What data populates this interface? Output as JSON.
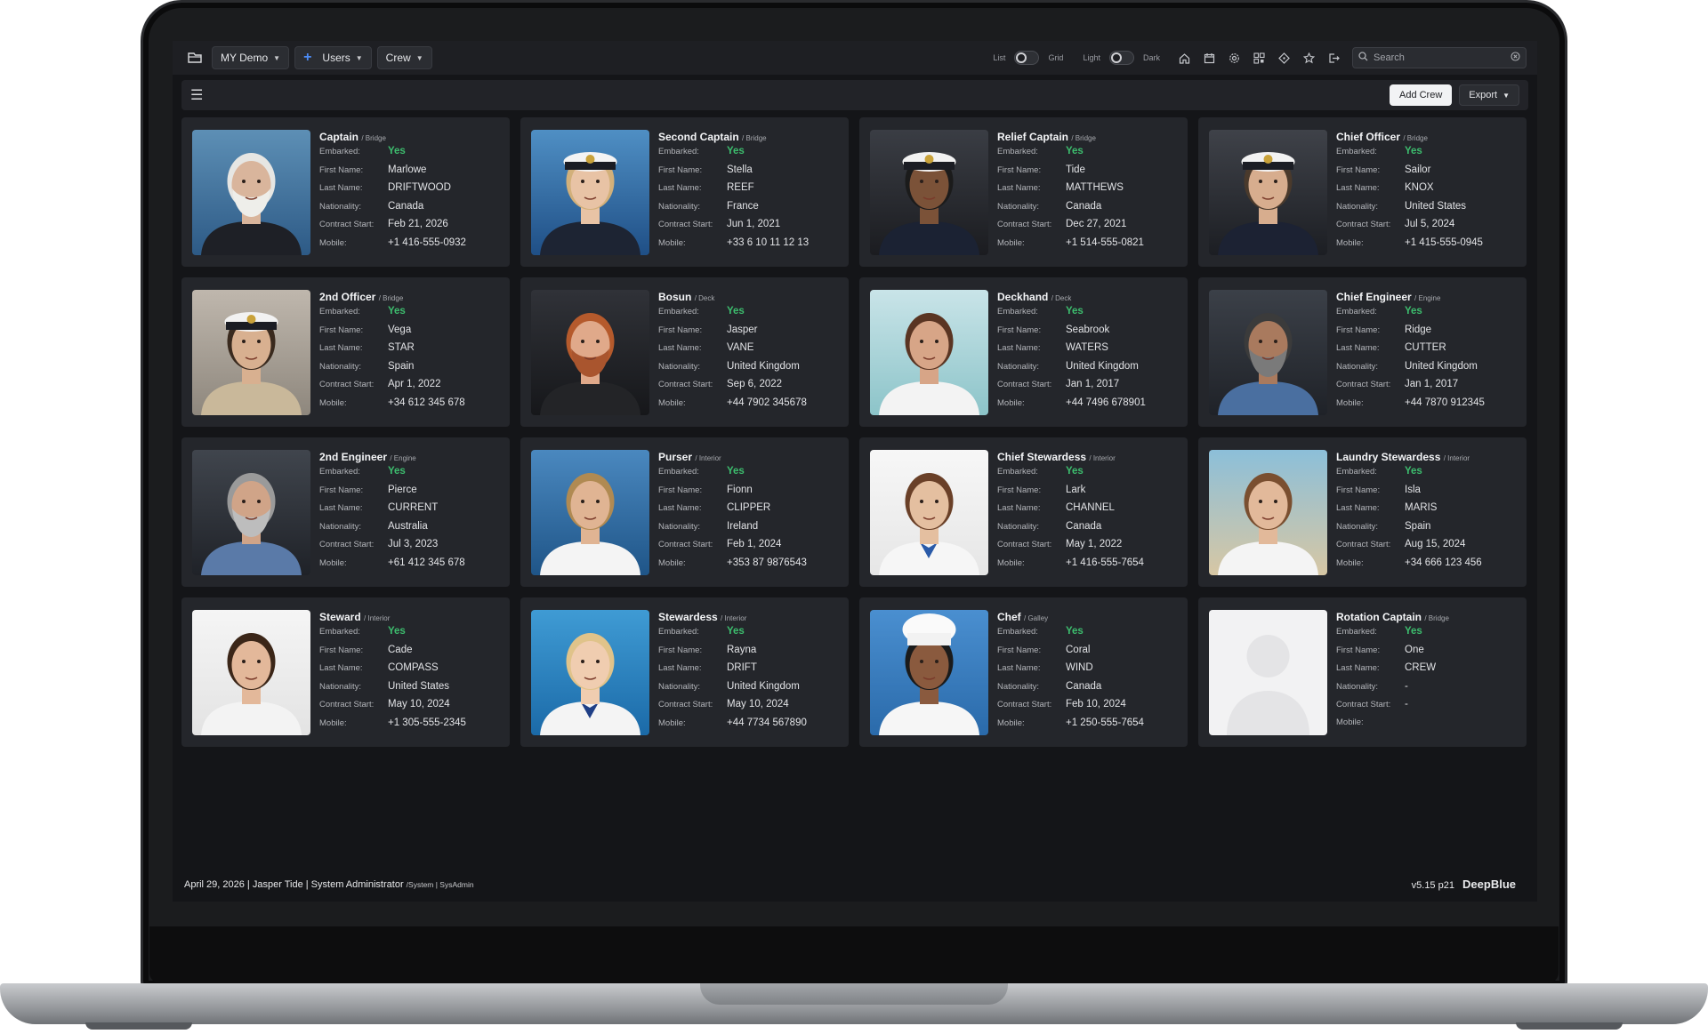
{
  "topbar": {
    "project": "MY Demo",
    "users": "Users",
    "crew": "Crew",
    "list_label": "List",
    "grid_label": "Grid",
    "light_label": "Light",
    "dark_label": "Dark",
    "search_placeholder": "Search",
    "icons": [
      "home-icon",
      "calendar-icon",
      "gear-icon",
      "qr-code-icon",
      "tag-icon",
      "star-icon",
      "logout-icon"
    ]
  },
  "toolbar": {
    "add_crew": "Add Crew",
    "export": "Export"
  },
  "labels": {
    "embarked": "Embarked:",
    "first_name": "First Name:",
    "last_name": "Last Name:",
    "nationality": "Nationality:",
    "contract_start": "Contract Start:",
    "mobile": "Mobile:"
  },
  "crew": [
    {
      "role": "Captain",
      "dept": "/ Bridge",
      "embarked": "Yes",
      "first": "Marlowe",
      "last": "DRIFTWOOD",
      "nationality": "Canada",
      "contract": "Feb 21, 2026",
      "mobile": "+1 416-555-0932",
      "photo": "captain-beard"
    },
    {
      "role": "Second Captain",
      "dept": "/ Bridge",
      "embarked": "Yes",
      "first": "Stella",
      "last": "REEF",
      "nationality": "France",
      "contract": "Jun 1, 2021",
      "mobile": "+33 6 10 11 12 13",
      "photo": "officer-woman-sea"
    },
    {
      "role": "Relief Captain",
      "dept": "/ Bridge",
      "embarked": "Yes",
      "first": "Tide",
      "last": "MATTHEWS",
      "nationality": "Canada",
      "contract": "Dec 27, 2021",
      "mobile": "+1 514-555-0821",
      "photo": "officer-cap-dark"
    },
    {
      "role": "Chief Officer",
      "dept": "/ Bridge",
      "embarked": "Yes",
      "first": "Sailor",
      "last": "KNOX",
      "nationality": "United States",
      "contract": "Jul 5, 2024",
      "mobile": "+1 415-555-0945",
      "photo": "officer-cap-light"
    },
    {
      "role": "2nd Officer",
      "dept": "/ Bridge",
      "embarked": "Yes",
      "first": "Vega",
      "last": "STAR",
      "nationality": "Spain",
      "contract": "Apr 1, 2022",
      "mobile": "+34 612 345 678",
      "photo": "officer-cap-beige"
    },
    {
      "role": "Bosun",
      "dept": "/ Deck",
      "embarked": "Yes",
      "first": "Jasper",
      "last": "VANE",
      "nationality": "United Kingdom",
      "contract": "Sep 6, 2022",
      "mobile": "+44 7902 345678",
      "photo": "bosun-red"
    },
    {
      "role": "Deckhand",
      "dept": "/ Deck",
      "embarked": "Yes",
      "first": "Seabrook",
      "last": "WATERS",
      "nationality": "United Kingdom",
      "contract": "Jan 1, 2017",
      "mobile": "+44 7496 678901",
      "photo": "deckhand-woman"
    },
    {
      "role": "Chief Engineer",
      "dept": "/ Engine",
      "embarked": "Yes",
      "first": "Ridge",
      "last": "CUTTER",
      "nationality": "United Kingdom",
      "contract": "Jan 1, 2017",
      "mobile": "+44 7870 912345",
      "photo": "engineer-engine"
    },
    {
      "role": "2nd Engineer",
      "dept": "/ Engine",
      "embarked": "Yes",
      "first": "Pierce",
      "last": "CURRENT",
      "nationality": "Australia",
      "contract": "Jul 3, 2023",
      "mobile": "+61 412 345 678",
      "photo": "engineer-grey"
    },
    {
      "role": "Purser",
      "dept": "/ Interior",
      "embarked": "Yes",
      "first": "Fionn",
      "last": "CLIPPER",
      "nationality": "Ireland",
      "contract": "Feb 1, 2024",
      "mobile": "+353 87 9876543",
      "photo": "purser-sea"
    },
    {
      "role": "Chief Stewardess",
      "dept": "/ Interior",
      "embarked": "Yes",
      "first": "Lark",
      "last": "CHANNEL",
      "nationality": "Canada",
      "contract": "May 1, 2022",
      "mobile": "+1 416-555-7654",
      "photo": "stewardess-white"
    },
    {
      "role": "Laundry Stewardess",
      "dept": "/ Interior",
      "embarked": "Yes",
      "first": "Isla",
      "last": "MARIS",
      "nationality": "Spain",
      "contract": "Aug 15, 2024",
      "mobile": "+34 666 123 456",
      "photo": "stewardess-beach"
    },
    {
      "role": "Steward",
      "dept": "/ Interior",
      "embarked": "Yes",
      "first": "Cade",
      "last": "COMPASS",
      "nationality": "United States",
      "contract": "May 10, 2024",
      "mobile": "+1 305-555-2345",
      "photo": "steward-white"
    },
    {
      "role": "Stewardess",
      "dept": "/ Interior",
      "embarked": "Yes",
      "first": "Rayna",
      "last": "DRIFT",
      "nationality": "United Kingdom",
      "contract": "May 10, 2024",
      "mobile": "+44 7734 567890",
      "photo": "stewardess-blue"
    },
    {
      "role": "Chef",
      "dept": "/ Galley",
      "embarked": "Yes",
      "first": "Coral",
      "last": "WIND",
      "nationality": "Canada",
      "contract": "Feb 10, 2024",
      "mobile": "+1 250-555-7654",
      "photo": "chef"
    },
    {
      "role": "Rotation Captain",
      "dept": "/ Bridge",
      "embarked": "Yes",
      "first": "One",
      "last": "CREW",
      "nationality": "-",
      "contract": "-",
      "mobile": "",
      "photo": "placeholder"
    }
  ],
  "footer": {
    "status": "April 29, 2026 | Jasper Tide | System Administrator",
    "status_small": "/System | SysAdmin",
    "version": "v5.15 p21",
    "brand": "DeepBlue"
  }
}
